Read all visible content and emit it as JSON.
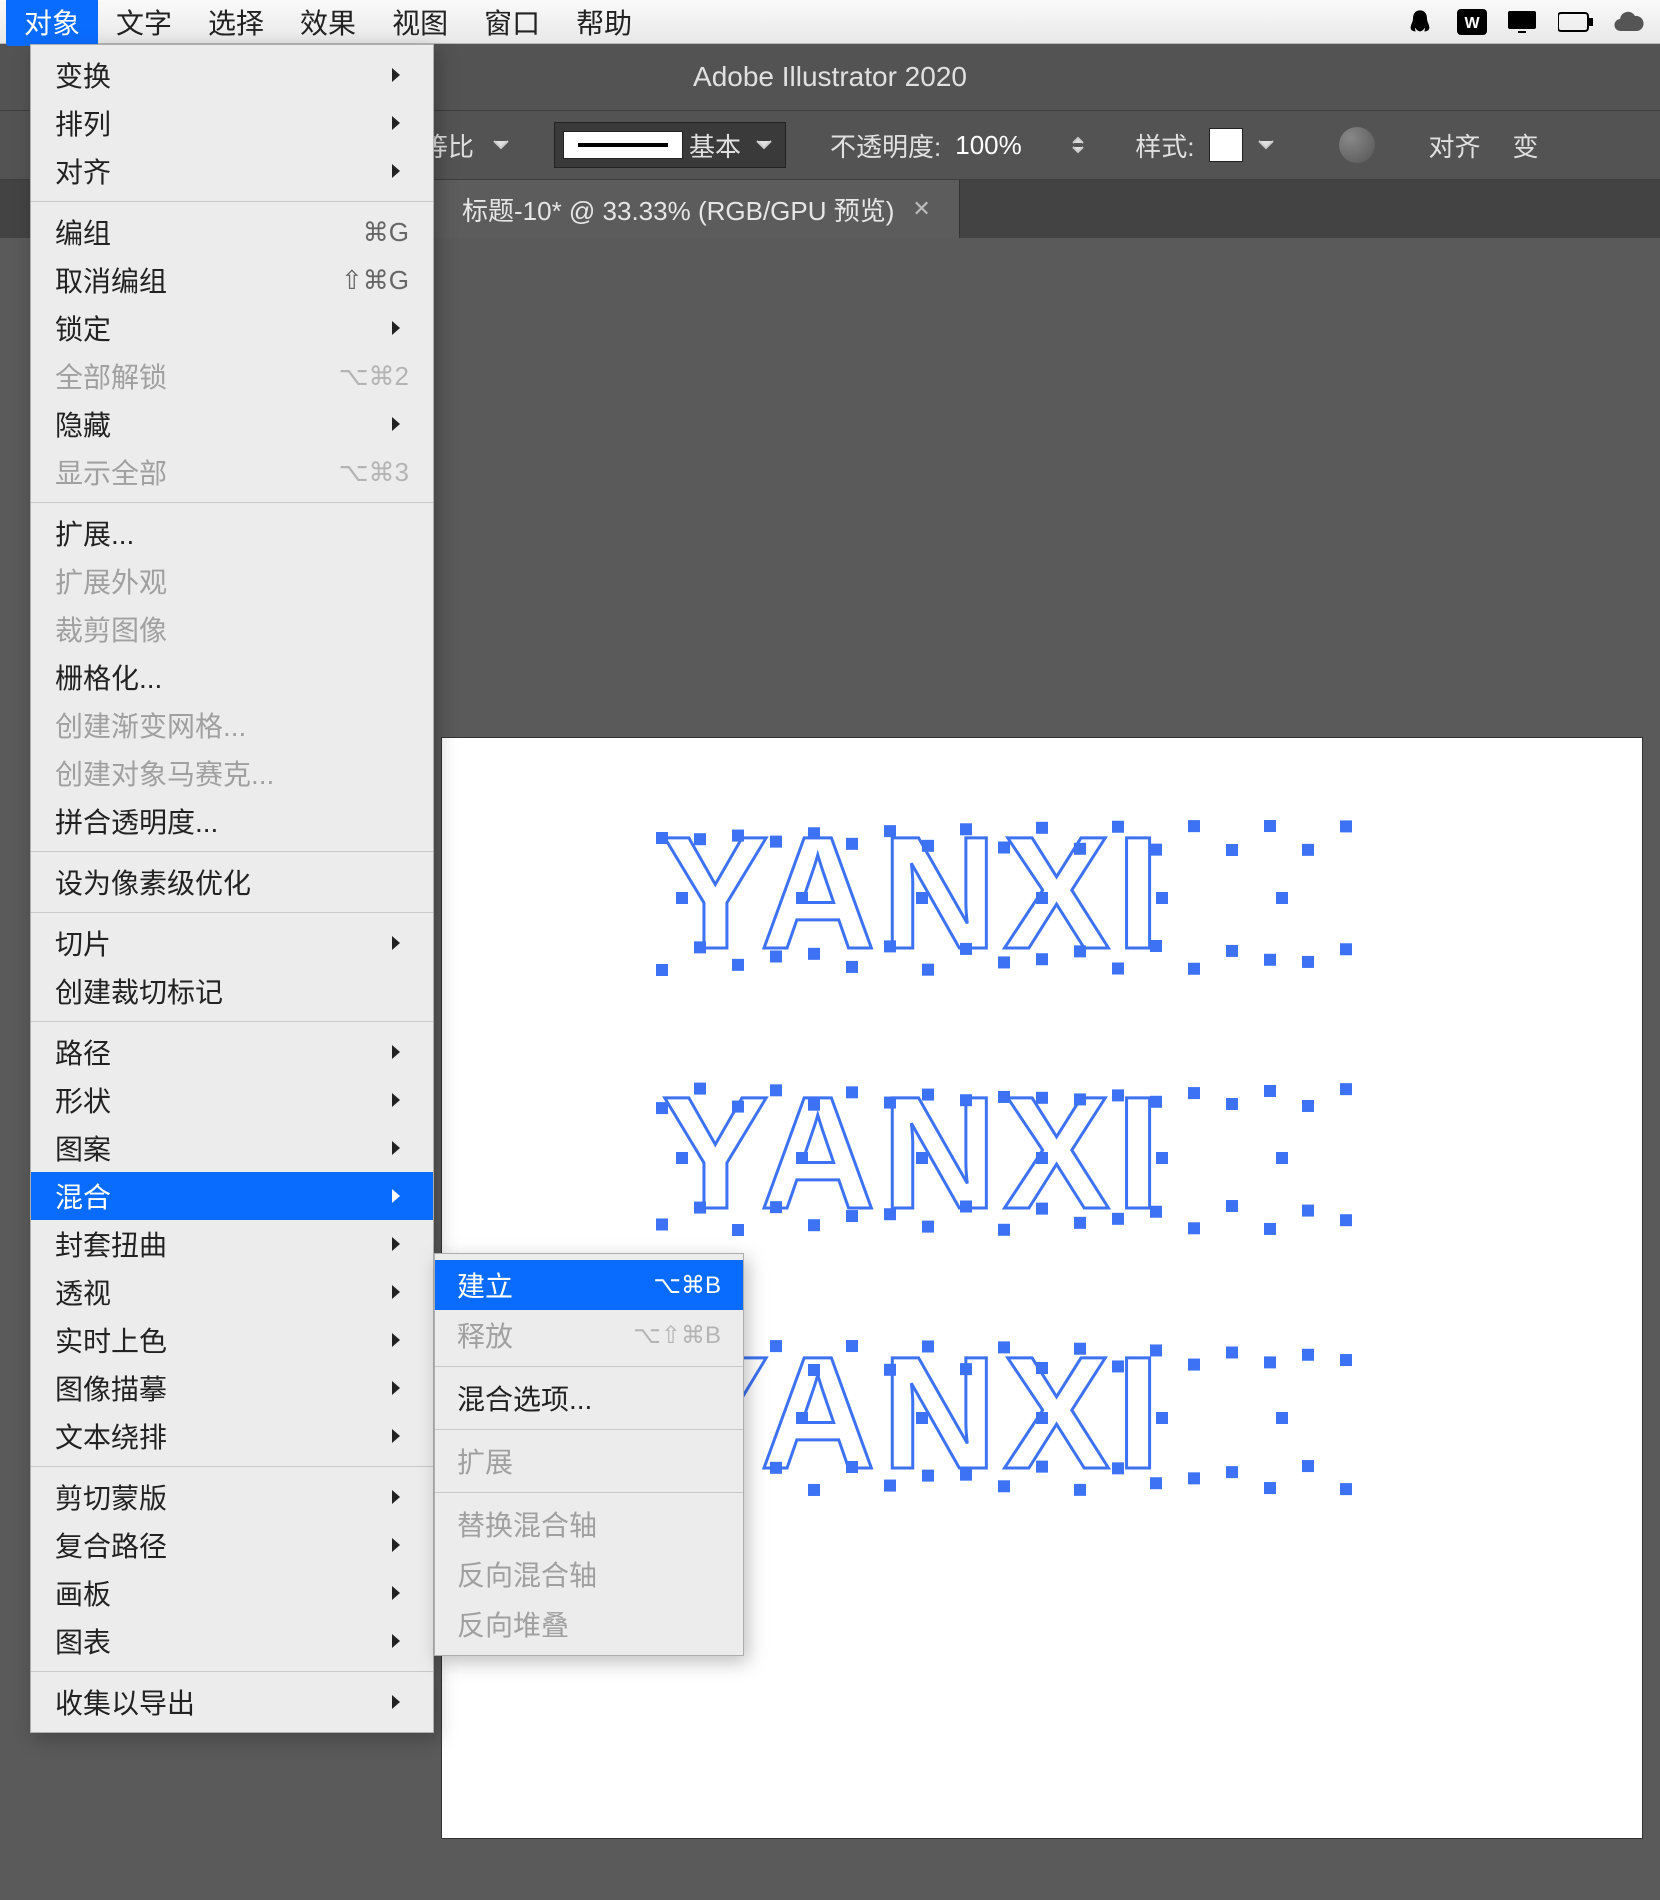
{
  "menubar": {
    "items": [
      "对象",
      "文字",
      "选择",
      "效果",
      "视图",
      "窗口",
      "帮助"
    ],
    "active_index": 0
  },
  "app_title": "Adobe Illustrator 2020",
  "controlbar": {
    "scale_label": "等比",
    "stroke_preset_label": "基本",
    "opacity_label": "不透明度:",
    "opacity_value": "100%",
    "style_label": "样式:",
    "align_label": "对齐",
    "truncated_right": "变"
  },
  "tab": {
    "title": "标题-10* @ 33.33% (RGB/GPU 预览)",
    "left_fragment": ""
  },
  "artboard": {
    "text_rows": [
      "YANXI",
      "YANXI",
      "YANXI"
    ]
  },
  "object_menu": {
    "sections": [
      [
        {
          "label": "变换",
          "sub": true
        },
        {
          "label": "排列",
          "sub": true
        },
        {
          "label": "对齐",
          "sub": true
        }
      ],
      [
        {
          "label": "编组",
          "shortcut": "⌘G"
        },
        {
          "label": "取消编组",
          "shortcut": "⇧⌘G"
        },
        {
          "label": "锁定",
          "sub": true
        },
        {
          "label": "全部解锁",
          "shortcut": "⌥⌘2",
          "disabled": true
        },
        {
          "label": "隐藏",
          "sub": true
        },
        {
          "label": "显示全部",
          "shortcut": "⌥⌘3",
          "disabled": true
        }
      ],
      [
        {
          "label": "扩展..."
        },
        {
          "label": "扩展外观",
          "disabled": true
        },
        {
          "label": "裁剪图像",
          "disabled": true
        },
        {
          "label": "栅格化..."
        },
        {
          "label": "创建渐变网格...",
          "disabled": true
        },
        {
          "label": "创建对象马赛克...",
          "disabled": true
        },
        {
          "label": "拼合透明度..."
        }
      ],
      [
        {
          "label": "设为像素级优化"
        }
      ],
      [
        {
          "label": "切片",
          "sub": true
        },
        {
          "label": "创建裁切标记"
        }
      ],
      [
        {
          "label": "路径",
          "sub": true
        },
        {
          "label": "形状",
          "sub": true
        },
        {
          "label": "图案",
          "sub": true
        },
        {
          "label": "混合",
          "sub": true,
          "highlight": true
        },
        {
          "label": "封套扭曲",
          "sub": true
        },
        {
          "label": "透视",
          "sub": true
        },
        {
          "label": "实时上色",
          "sub": true
        },
        {
          "label": "图像描摹",
          "sub": true
        },
        {
          "label": "文本绕排",
          "sub": true
        }
      ],
      [
        {
          "label": "剪切蒙版",
          "sub": true
        },
        {
          "label": "复合路径",
          "sub": true
        },
        {
          "label": "画板",
          "sub": true
        },
        {
          "label": "图表",
          "sub": true
        }
      ],
      [
        {
          "label": "收集以导出",
          "sub": true
        }
      ]
    ]
  },
  "blend_submenu": {
    "sections": [
      [
        {
          "label": "建立",
          "shortcut": "⌥⌘B",
          "highlight": true
        },
        {
          "label": "释放",
          "shortcut": "⌥⇧⌘B",
          "disabled": true
        }
      ],
      [
        {
          "label": "混合选项..."
        }
      ],
      [
        {
          "label": "扩展",
          "disabled": true
        }
      ],
      [
        {
          "label": "替换混合轴",
          "disabled": true
        },
        {
          "label": "反向混合轴",
          "disabled": true
        },
        {
          "label": "反向堆叠",
          "disabled": true
        }
      ]
    ]
  }
}
